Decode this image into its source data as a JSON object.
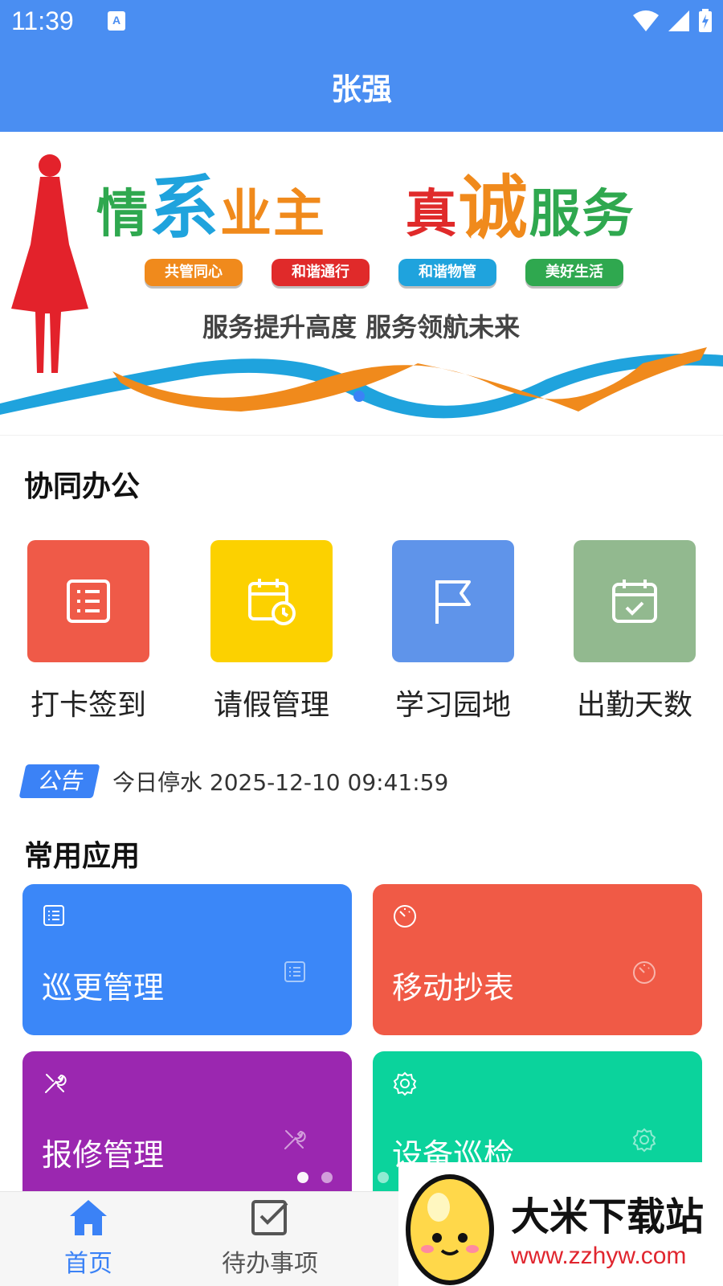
{
  "status_bar": {
    "time": "11:39",
    "notification_icon": "A"
  },
  "header": {
    "title": "张强"
  },
  "banner": {
    "headline_parts": [
      "情",
      "系",
      "业主",
      "真",
      "诚",
      "服务"
    ],
    "pills": [
      {
        "label": "共管同心",
        "color": "#f08a1c"
      },
      {
        "label": "和谐通行",
        "color": "#e02a2a"
      },
      {
        "label": "和谐物管",
        "color": "#1fa3dd"
      },
      {
        "label": "美好生活",
        "color": "#2fa84f"
      }
    ],
    "slogan": "服务提升高度 服务领航未来"
  },
  "collab": {
    "title": "协同办公",
    "items": [
      {
        "label": "打卡签到",
        "color": "#ef5a48",
        "icon": "list-icon"
      },
      {
        "label": "请假管理",
        "color": "#fcd100",
        "icon": "calendar-clock-icon"
      },
      {
        "label": "学习园地",
        "color": "#5f94ea",
        "icon": "flag-icon"
      },
      {
        "label": "出勤天数",
        "color": "#92b98f",
        "icon": "calendar-check-icon"
      }
    ]
  },
  "notice": {
    "tag": "公告",
    "text": "今日停水 2025-12-10 09:41:59"
  },
  "apps": {
    "title": "常用应用",
    "cards": [
      {
        "label": "巡更管理",
        "color": "#3b87f8",
        "icon": "list-icon"
      },
      {
        "label": "移动抄表",
        "color": "#f05a46",
        "icon": "gauge-icon"
      },
      {
        "label": "报修管理",
        "color": "#9b27b0",
        "icon": "tools-icon"
      },
      {
        "label": "设备巡检",
        "color": "#0bd39c",
        "icon": "gear-icon"
      }
    ]
  },
  "bottom_nav": {
    "items": [
      {
        "label": "首页",
        "icon": "home-icon",
        "active": true,
        "color": "#3b82f6"
      },
      {
        "label": "待办事项",
        "icon": "checkbox-icon",
        "active": false,
        "color": "#555555"
      }
    ]
  },
  "watermark": {
    "title": "大米下载站",
    "url": "www.zzhyw.com"
  }
}
